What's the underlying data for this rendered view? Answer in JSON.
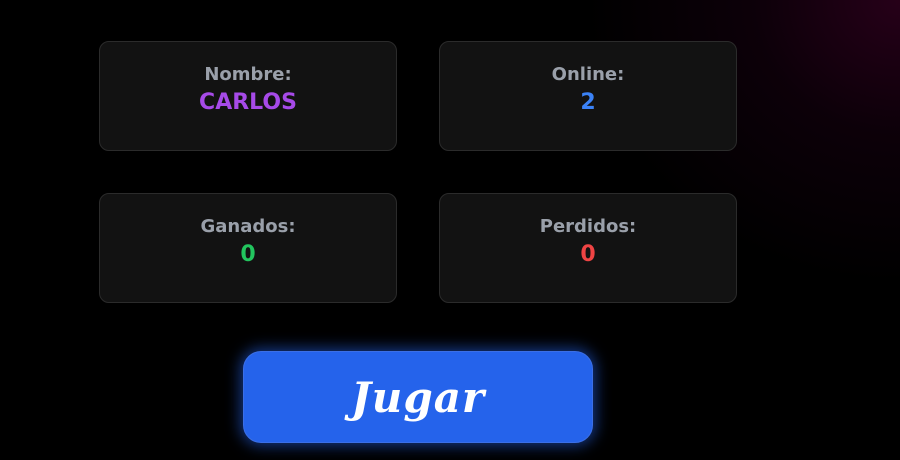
{
  "stats": {
    "nombre": {
      "label": "Nombre:",
      "value": "CARLOS",
      "color": "#a64ae8"
    },
    "online": {
      "label": "Online:",
      "value": "2",
      "color": "#3b82f6"
    },
    "ganados": {
      "label": "Ganados:",
      "value": "0",
      "color": "#22c55e"
    },
    "perdidos": {
      "label": "Perdidos:",
      "value": "0",
      "color": "#ef4444"
    }
  },
  "play_button": {
    "label": "Jugar",
    "color": "#2563eb"
  },
  "colors": {
    "background": "#000000",
    "card_background": "#121212",
    "label_text": "#9aa0aa"
  }
}
